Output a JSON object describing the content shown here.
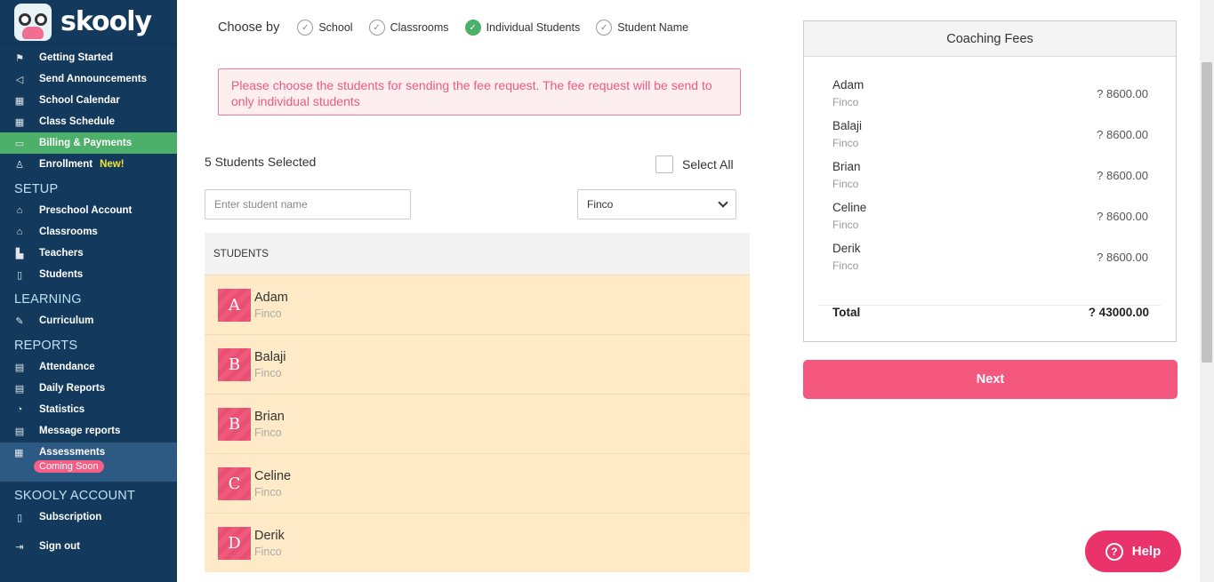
{
  "app": {
    "name": "skooly"
  },
  "sidebar": {
    "items_top": [
      {
        "label": "Getting Started",
        "icon": "flag-icon"
      },
      {
        "label": "Send Announcements",
        "icon": "megaphone-icon"
      },
      {
        "label": "School Calendar",
        "icon": "calendar-icon"
      },
      {
        "label": "Class Schedule",
        "icon": "schedule-icon"
      },
      {
        "label": "Billing & Payments",
        "icon": "billing-icon",
        "active": true
      },
      {
        "label": "Enrollment",
        "icon": "user-add-icon",
        "badge": "New!"
      }
    ],
    "setup_title": "SETUP",
    "setup": [
      "Preschool Account",
      "Classrooms",
      "Teachers",
      "Students"
    ],
    "learning_title": "LEARNING",
    "learning": [
      "Curriculum"
    ],
    "reports_title": "REPORTS",
    "reports": [
      "Attendance",
      "Daily Reports",
      "Statistics",
      "Message reports"
    ],
    "assessments": {
      "label": "Assessments",
      "badge": "Coming Soon"
    },
    "account_title": "SKOOLY ACCOUNT",
    "subscription": "Subscription",
    "signout": "Sign out",
    "colors": {
      "bg": "#133a5c",
      "active": "#4caf6a",
      "section": "#bfe0f5"
    }
  },
  "choose": {
    "label": "Choose by",
    "options": [
      {
        "label": "School",
        "selected": false
      },
      {
        "label": "Classrooms",
        "selected": false
      },
      {
        "label": "Individual Students",
        "selected": true
      },
      {
        "label": "Student Name",
        "selected": false
      }
    ]
  },
  "alert": {
    "text": "Please choose the students for sending the fee request. The fee request will be send to only individual students"
  },
  "selection": {
    "count_text": "5 Students Selected",
    "select_all": "Select All"
  },
  "search": {
    "placeholder": "Enter student name"
  },
  "filter": {
    "value": "Finco"
  },
  "students_header": "STUDENTS",
  "students": [
    {
      "initial": "A",
      "name": "Adam",
      "sub": "Finco"
    },
    {
      "initial": "B",
      "name": "Balaji",
      "sub": "Finco"
    },
    {
      "initial": "B",
      "name": "Brian",
      "sub": "Finco"
    },
    {
      "initial": "C",
      "name": "Celine",
      "sub": "Finco"
    },
    {
      "initial": "D",
      "name": "Derik",
      "sub": "Finco"
    }
  ],
  "fees": {
    "title": "Coaching Fees",
    "rows": [
      {
        "name": "Adam",
        "sub": "Finco",
        "amount": "? 8600.00"
      },
      {
        "name": "Balaji",
        "sub": "Finco",
        "amount": "? 8600.00"
      },
      {
        "name": "Brian",
        "sub": "Finco",
        "amount": "? 8600.00"
      },
      {
        "name": "Celine",
        "sub": "Finco",
        "amount": "? 8600.00"
      },
      {
        "name": "Derik",
        "sub": "Finco",
        "amount": "? 8600.00"
      }
    ],
    "total_label": "Total",
    "total_amount": "? 43000.00"
  },
  "next_label": "Next",
  "help_label": "Help"
}
